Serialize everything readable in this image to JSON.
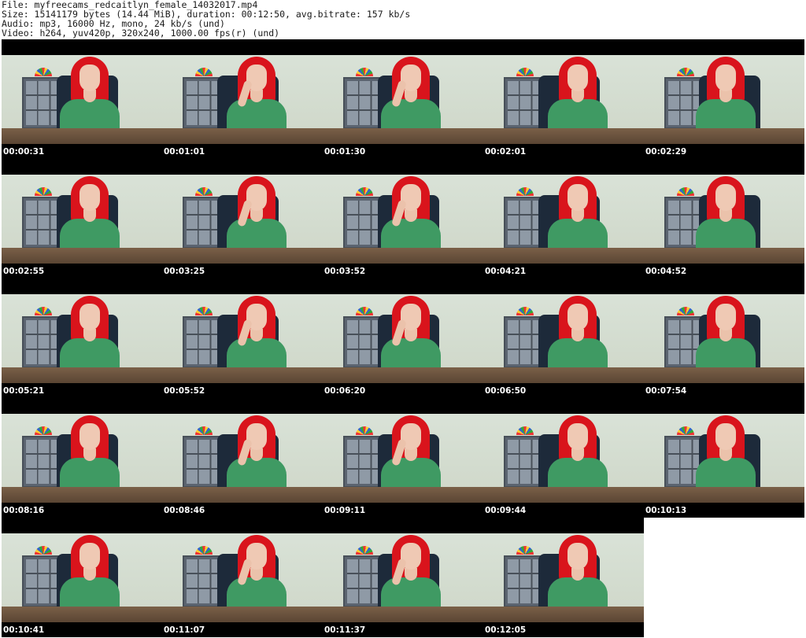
{
  "header": {
    "file_line": "File: myfreecams_redcaitlyn_female_14032017.mp4",
    "size_line": "Size: 15141179 bytes (14.44 MiB), duration: 00:12:50, avg.bitrate: 157 kb/s",
    "audio_line": "Audio: mp3, 16000 Hz, mono, 24 kb/s (und)",
    "video_line": "Video: h264, yuv420p, 320x240, 1000.00 fps(r) (und)"
  },
  "thumbnails": [
    {
      "timestamp": "00:00:31"
    },
    {
      "timestamp": "00:01:01"
    },
    {
      "timestamp": "00:01:30"
    },
    {
      "timestamp": "00:02:01"
    },
    {
      "timestamp": "00:02:29"
    },
    {
      "timestamp": "00:02:55"
    },
    {
      "timestamp": "00:03:25"
    },
    {
      "timestamp": "00:03:52"
    },
    {
      "timestamp": "00:04:21"
    },
    {
      "timestamp": "00:04:52"
    },
    {
      "timestamp": "00:05:21"
    },
    {
      "timestamp": "00:05:52"
    },
    {
      "timestamp": "00:06:20"
    },
    {
      "timestamp": "00:06:50"
    },
    {
      "timestamp": "00:07:54"
    },
    {
      "timestamp": "00:08:16"
    },
    {
      "timestamp": "00:08:46"
    },
    {
      "timestamp": "00:09:11"
    },
    {
      "timestamp": "00:09:44"
    },
    {
      "timestamp": "00:10:13"
    },
    {
      "timestamp": "00:10:41"
    },
    {
      "timestamp": "00:11:07"
    },
    {
      "timestamp": "00:11:37"
    },
    {
      "timestamp": "00:12:05"
    }
  ]
}
